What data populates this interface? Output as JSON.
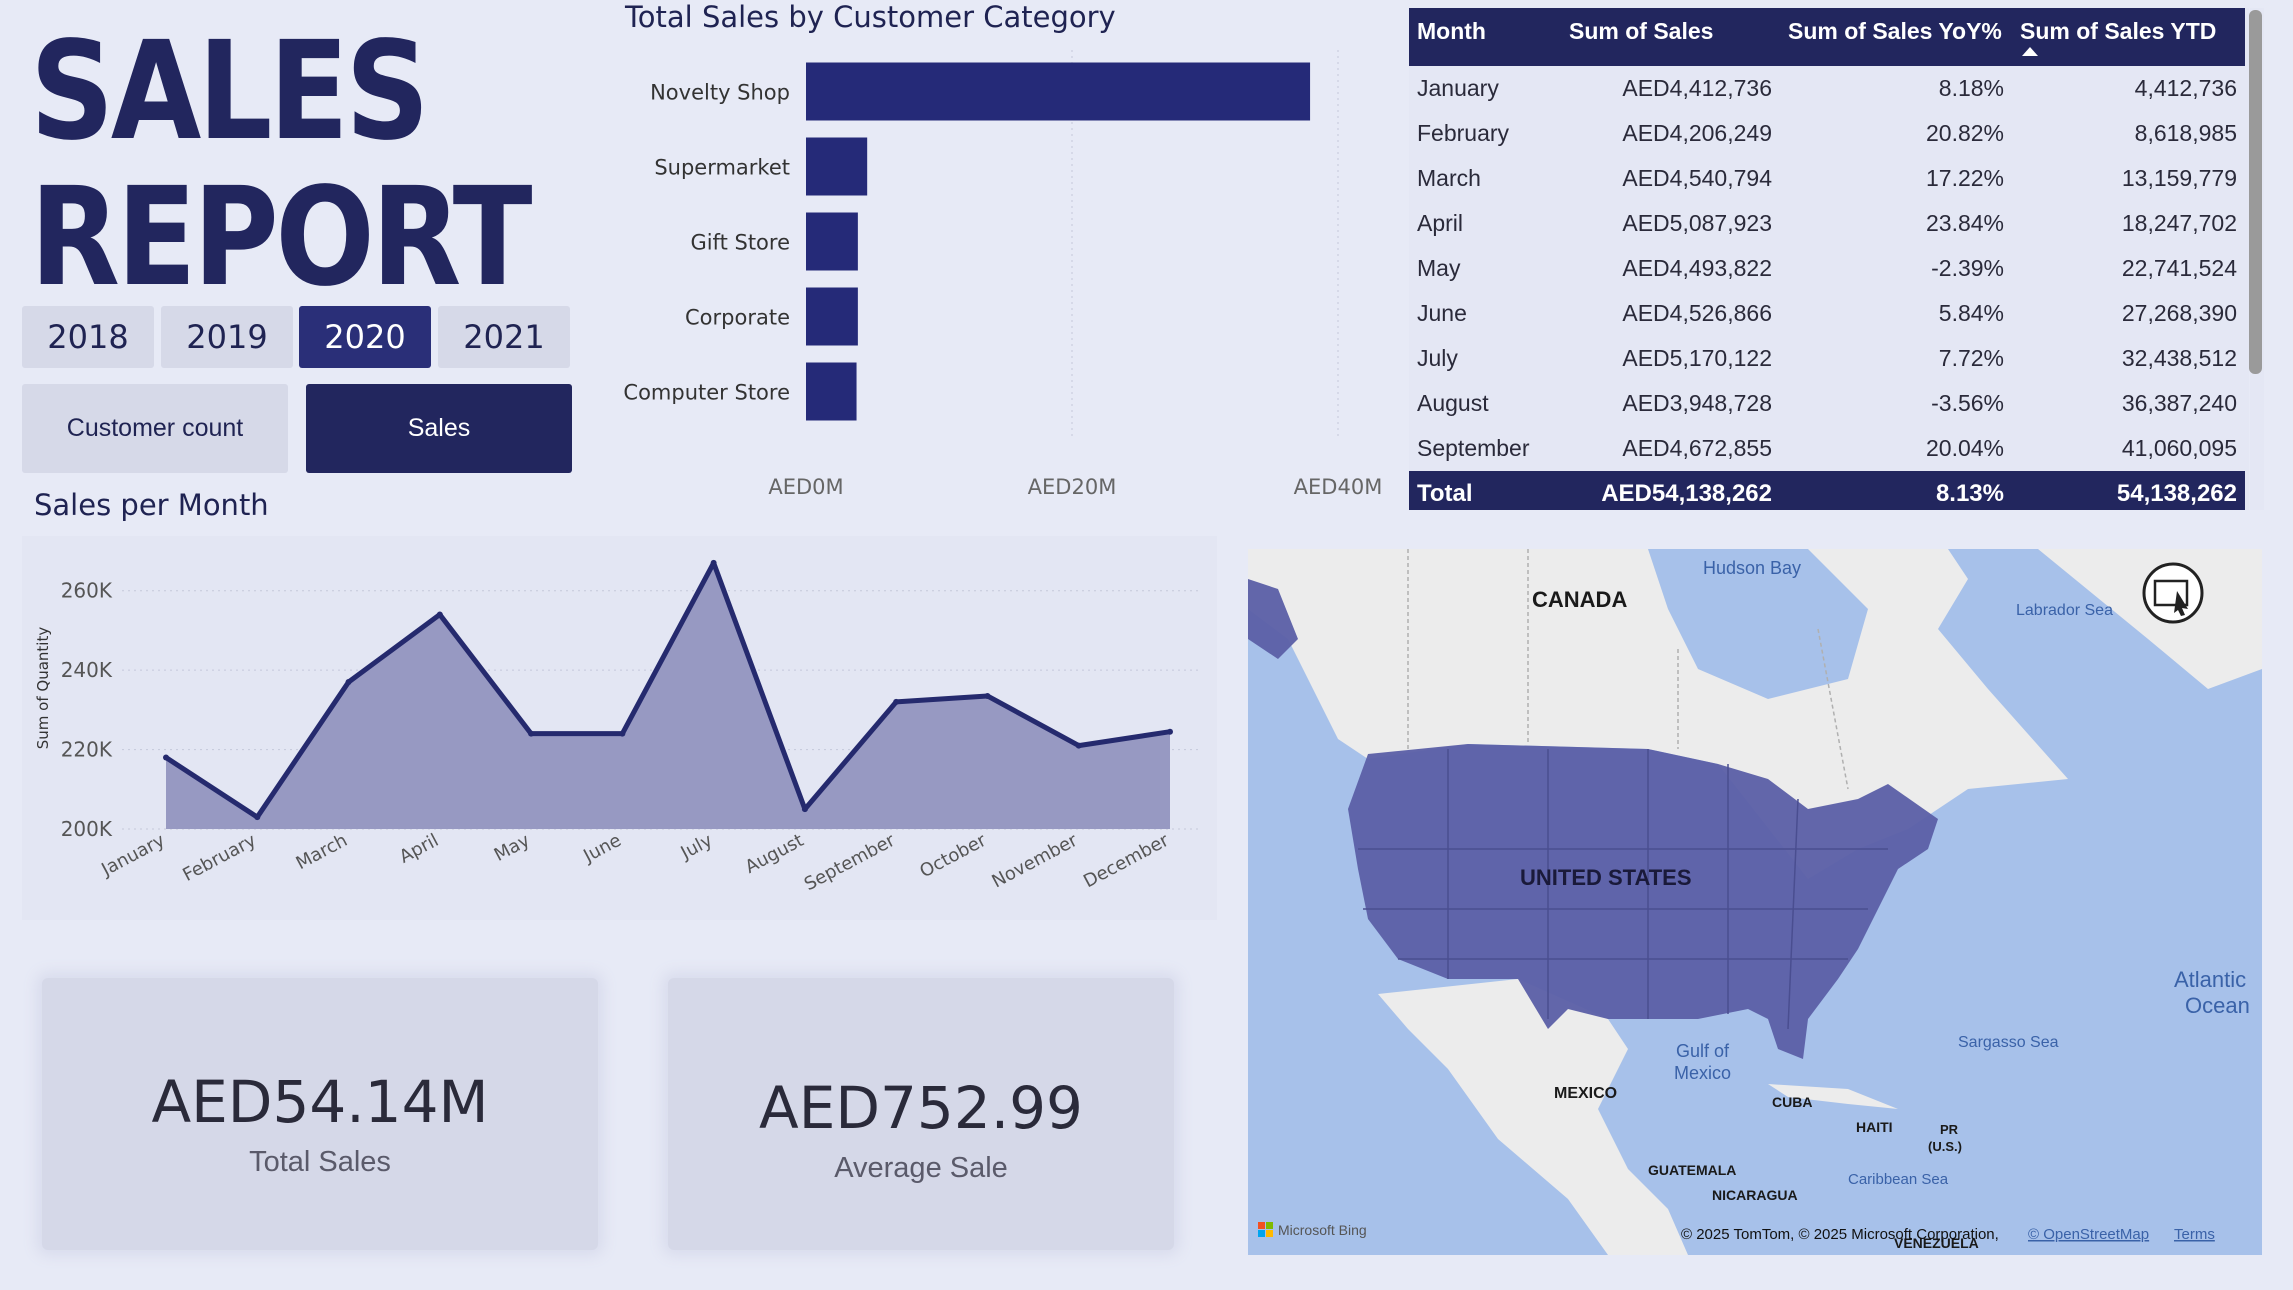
{
  "report": {
    "title_line1": "SALES",
    "title_line2": "REPORT"
  },
  "years": [
    {
      "label": "2018",
      "active": false
    },
    {
      "label": "2019",
      "active": false
    },
    {
      "label": "2020",
      "active": true
    },
    {
      "label": "2021",
      "active": false
    }
  ],
  "toggles": {
    "customer_count": "Customer count",
    "sales": "Sales",
    "selected": "sales"
  },
  "chart_data": [
    {
      "type": "bar",
      "orientation": "horizontal",
      "title": "Total Sales by Customer Category",
      "categories": [
        "Novelty Shop",
        "Supermarket",
        "Gift Store",
        "Corporate",
        "Computer Store"
      ],
      "values": [
        37.9,
        4.6,
        3.9,
        3.9,
        3.8
      ],
      "value_unit": "AED millions",
      "xlim": [
        0,
        40
      ],
      "xticks": [
        "AED0M",
        "AED20M",
        "AED40M"
      ],
      "grid": true,
      "color": "#252a78"
    },
    {
      "type": "area",
      "title": "Sales per Month",
      "ylabel": "Sum of Quantity",
      "categories": [
        "January",
        "February",
        "March",
        "April",
        "May",
        "June",
        "July",
        "August",
        "September",
        "October",
        "November",
        "December"
      ],
      "values": [
        218000,
        203000,
        237000,
        254000,
        224000,
        224000,
        267000,
        205000,
        232000,
        233500,
        221000,
        224500
      ],
      "ylim": [
        200000,
        270000
      ],
      "yticks": [
        "200K",
        "220K",
        "240K",
        "260K"
      ],
      "grid": true,
      "line_color": "#252a6e",
      "fill_color": "#9799c2"
    }
  ],
  "table": {
    "headers": [
      "Month",
      "Sum of Sales",
      "Sum of Sales YoY%",
      "Sum of Sales YTD"
    ],
    "rows": [
      [
        "January",
        "AED4,412,736",
        "8.18%",
        "4,412,736"
      ],
      [
        "February",
        "AED4,206,249",
        "20.82%",
        "8,618,985"
      ],
      [
        "March",
        "AED4,540,794",
        "17.22%",
        "13,159,779"
      ],
      [
        "April",
        "AED5,087,923",
        "23.84%",
        "18,247,702"
      ],
      [
        "May",
        "AED4,493,822",
        "-2.39%",
        "22,741,524"
      ],
      [
        "June",
        "AED4,526,866",
        "5.84%",
        "27,268,390"
      ],
      [
        "July",
        "AED5,170,122",
        "7.72%",
        "32,438,512"
      ],
      [
        "August",
        "AED3,948,728",
        "-3.56%",
        "36,387,240"
      ],
      [
        "September",
        "AED4,672,855",
        "20.04%",
        "41,060,095"
      ]
    ],
    "total": [
      "Total",
      "AED54,138,262",
      "8.13%",
      "54,138,262"
    ]
  },
  "kpis": {
    "total_sales_value": "AED54.14M",
    "total_sales_label": "Total Sales",
    "average_sale_value": "AED752.99",
    "average_sale_label": "Average Sale"
  },
  "map": {
    "labels": {
      "canada": "CANADA",
      "united_states": "UNITED STATES",
      "mexico": "MEXICO",
      "hudson_bay": "Hudson Bay",
      "labrador_sea": "Labrador Sea",
      "atlantic_1": "Atlantic",
      "atlantic_2": "Ocean",
      "sargasso": "Sargasso Sea",
      "gulf_1": "Gulf of",
      "gulf_2": "Mexico",
      "cuba": "CUBA",
      "haiti": "HAITI",
      "pr_1": "PR",
      "pr_2": "(U.S.)",
      "guatemala": "GUATEMALA",
      "nicaragua": "NICARAGUA",
      "caribbean": "Caribbean Sea",
      "venezuela": "VENEZUELA"
    },
    "attribution": "© 2025 TomTom, © 2025 Microsoft Corporation,",
    "osm_link": "© OpenStreetMap",
    "terms_link": "Terms",
    "logo": "Microsoft Bing",
    "highlight_color": "#5b5fa6"
  }
}
